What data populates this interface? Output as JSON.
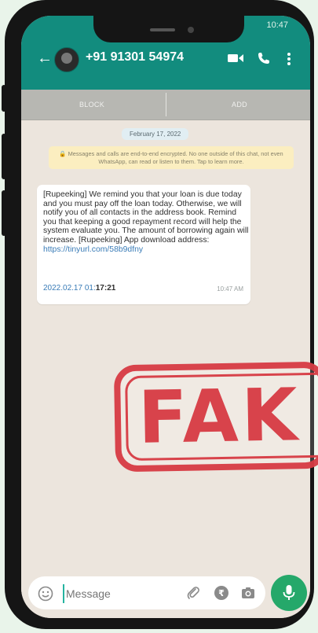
{
  "header": {
    "status_time": "10:47",
    "back_icon": "arrow-left-icon",
    "contact_name": "+91 91301 54974",
    "video_icon": "video-call-icon",
    "call_icon": "phone-icon",
    "menu_icon": "more-vert-icon"
  },
  "actions": {
    "block_label": "BLOCK",
    "add_label": "ADD"
  },
  "chat": {
    "date": "February 17, 2022",
    "encryption_notice": "🔒 Messages and calls are end-to-end encrypted. No one outside of this chat, not even WhatsApp, can read or listen to them. Tap to learn more.",
    "message": {
      "body": "[Rupeeking] We remind you that your loan is due today and you must pay off the loan today. Otherwise, we will notify you of all contacts in the address book. Remind you that keeping a good repayment record will help the system evaluate you. The amount of borrowing again will increase. [Rupeeking] App download address:",
      "link": "https://tinyurl.com/58b9dfny",
      "timestamp_prefix": "2022.02.17 01:",
      "timestamp_suffix": "17:21",
      "time": "10:47 AM"
    }
  },
  "overlay": {
    "stamp_text": "FAK"
  },
  "composer": {
    "placeholder": "Message",
    "emoji_icon": "emoji-icon",
    "attach_icon": "paperclip-icon",
    "rupee_icon": "rupee-icon",
    "camera_icon": "camera-icon",
    "mic_icon": "microphone-icon"
  },
  "colors": {
    "header": "#128c7e",
    "chat_bg": "#ece5dd",
    "stamp": "#d73b44",
    "mic": "#25a86a",
    "link": "#3a7cb7"
  }
}
